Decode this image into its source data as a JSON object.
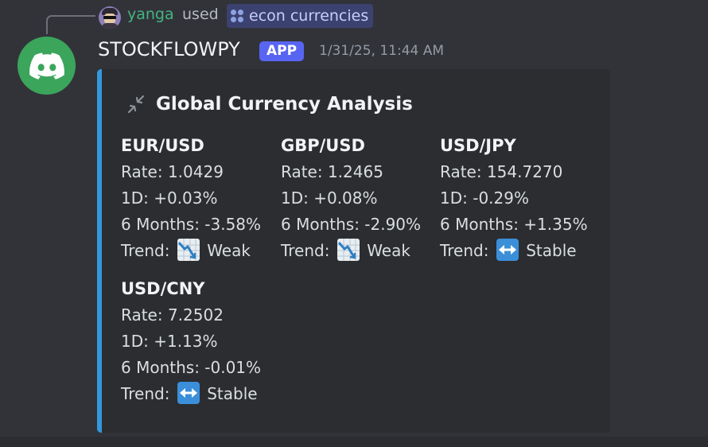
{
  "reply": {
    "username": "yanga",
    "used_text": "used",
    "command": "econ currencies"
  },
  "message": {
    "bot_name": "STOCKFLOWPY",
    "badge": "APP",
    "timestamp": "1/31/25, 11:44 AM"
  },
  "embed": {
    "accent_color": "#3498db",
    "title": "Global Currency Analysis",
    "fields": [
      {
        "name": "EUR/USD",
        "rate": "Rate: 1.0429",
        "d1": "1D: +0.03%",
        "m6": "6 Months: -3.58%",
        "trend_label": "Trend:",
        "trend_icon": "chart-decreasing-icon",
        "trend": "Weak"
      },
      {
        "name": "GBP/USD",
        "rate": "Rate: 1.2465",
        "d1": "1D: +0.08%",
        "m6": "6 Months: -2.90%",
        "trend_label": "Trend:",
        "trend_icon": "chart-decreasing-icon",
        "trend": "Weak"
      },
      {
        "name": "USD/JPY",
        "rate": "Rate: 154.7270",
        "d1": "1D: -0.29%",
        "m6": "6 Months: +1.35%",
        "trend_label": "Trend:",
        "trend_icon": "left-right-arrow-icon",
        "trend": "Stable"
      },
      {
        "name": "USD/CNY",
        "rate": "Rate: 7.2502",
        "d1": "1D: +1.13%",
        "m6": "6 Months: -0.01%",
        "trend_label": "Trend:",
        "trend_icon": "left-right-arrow-icon",
        "trend": "Stable"
      }
    ]
  }
}
